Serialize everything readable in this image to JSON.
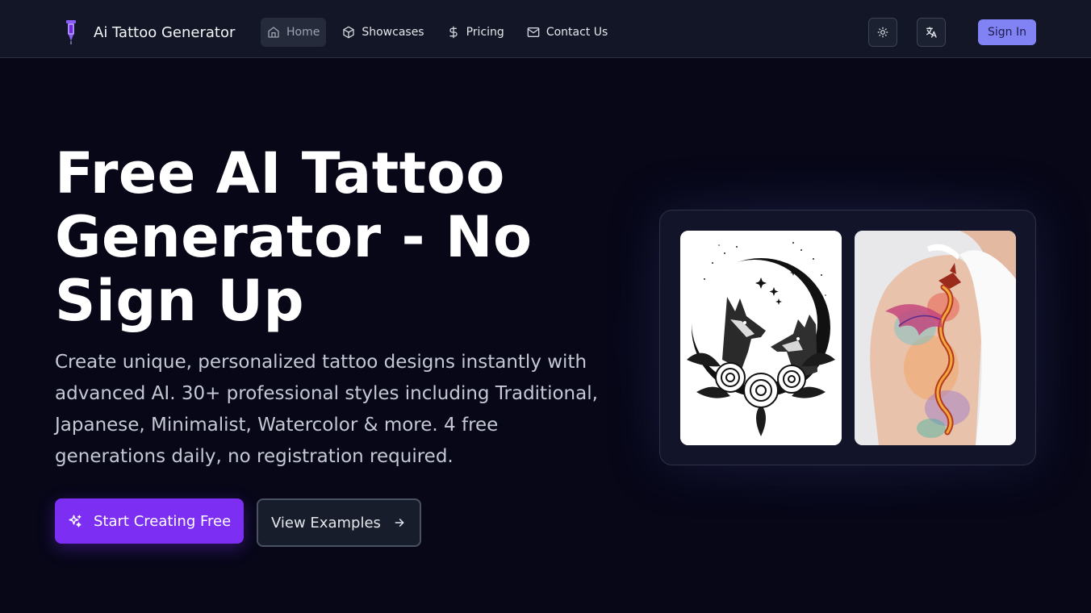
{
  "header": {
    "brand": "Ai Tattoo Generator",
    "nav": [
      {
        "label": "Home",
        "icon": "home-icon",
        "active": true
      },
      {
        "label": "Showcases",
        "icon": "cube-icon",
        "active": false
      },
      {
        "label": "Pricing",
        "icon": "dollar-icon",
        "active": false
      },
      {
        "label": "Contact Us",
        "icon": "mail-icon",
        "active": false
      }
    ],
    "theme_icon": "sun-icon",
    "language_icon": "translate-icon",
    "signin_label": "Sign In"
  },
  "hero": {
    "title": "Free AI Tattoo Generator - No Sign Up",
    "description": "Create unique, personalized tattoo designs instantly with advanced AI. 30+ professional styles including Traditional, Japanese, Minimalist, Watercolor & more. 4 free generations daily, no registration required.",
    "primary_button": "Start Creating Free",
    "primary_icon": "sparkles-icon",
    "secondary_button": "View Examples",
    "secondary_icon": "arrow-right-icon"
  },
  "showcase": {
    "images": [
      {
        "name": "wolves-moon-roses-tattoo"
      },
      {
        "name": "watercolor-dragon-arm-tattoo"
      }
    ]
  },
  "colors": {
    "background": "#070718",
    "header": "#121626",
    "primary": "#7c2ff3",
    "signin": "#8183f4"
  }
}
